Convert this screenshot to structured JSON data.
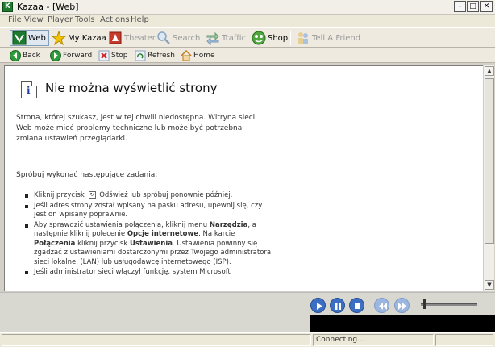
{
  "window": {
    "title": "Kazaa - [Web]",
    "icon_letter": "K"
  },
  "menu": [
    "File",
    "View",
    "Player",
    "Tools",
    "Actions",
    "Help"
  ],
  "toolbar": [
    {
      "label": "Web",
      "icon": "globe-icon",
      "state": "active"
    },
    {
      "label": "My Kazaa",
      "icon": "star-icon",
      "state": "normal"
    },
    {
      "label": "Theater",
      "icon": "theater-icon",
      "state": "disabled"
    },
    {
      "label": "Search",
      "icon": "magnifier-icon",
      "state": "disabled"
    },
    {
      "label": "Traffic",
      "icon": "traffic-icon",
      "state": "disabled"
    },
    {
      "label": "Shop",
      "icon": "shop-icon",
      "state": "normal"
    },
    {
      "label": "Tell A Friend",
      "icon": "people-icon",
      "state": "disabled"
    }
  ],
  "nav": [
    {
      "label": "Back",
      "icon": "back-icon"
    },
    {
      "label": "Forward",
      "icon": "forward-icon"
    },
    {
      "label": "Stop",
      "icon": "stop-icon"
    },
    {
      "label": "Refresh",
      "icon": "refresh-icon"
    },
    {
      "label": "Home",
      "icon": "home-icon"
    }
  ],
  "page": {
    "title": "Nie można wyświetlić strony",
    "description": "Strona, której szukasz, jest w tej chwili niedostępna. Witryna sieci Web może mieć problemy techniczne lub może być potrzebna zmiana ustawień przeglądarki.",
    "try_label": "Spróbuj wykonać następujące zadania:",
    "tips": [
      {
        "a": "Kliknij przycisk",
        "b": "Odśwież lub spróbuj ponownie później."
      },
      {
        "a": "Jeśli adres strony został wpisany na pasku adresu, upewnij się, czy jest on wpisany poprawnie."
      },
      {
        "a": "Aby sprawdzić ustawienia połączenia, kliknij menu",
        "b1": "Narzędzia",
        "b2": ", a następnie kliknij polecenie",
        "b3": "Opcje internetowe",
        "b4": ". Na karcie",
        "b5": "Połączenia",
        "b6": "kliknij przycisk",
        "b7": "Ustawienia",
        "b8": ". Ustawienia powinny się zgadzać z ustawieniami dostarczonymi przez Twojego administratora sieci lokalnej (LAN) lub usługodawcę internetowego (ISP)."
      },
      {
        "a": "Jeśli administrator sieci włączył funkcję, system Microsoft"
      }
    ]
  },
  "player": {
    "buttons": [
      {
        "name": "play-button",
        "icon": "play-icon",
        "dim": false
      },
      {
        "name": "pause-button",
        "icon": "pause-icon",
        "dim": false
      },
      {
        "name": "stop-button",
        "icon": "stop-square-icon",
        "dim": false
      },
      {
        "name": "previous-button",
        "icon": "prev-icon",
        "dim": true
      },
      {
        "name": "next-button",
        "icon": "next-icon",
        "dim": true
      }
    ],
    "volume": 0.05
  },
  "status": {
    "text": "Connecting..."
  },
  "colors": {
    "content_bg": "#ffffff",
    "chrome": "#ece9d8",
    "player_blue": "#3b6fc4"
  }
}
